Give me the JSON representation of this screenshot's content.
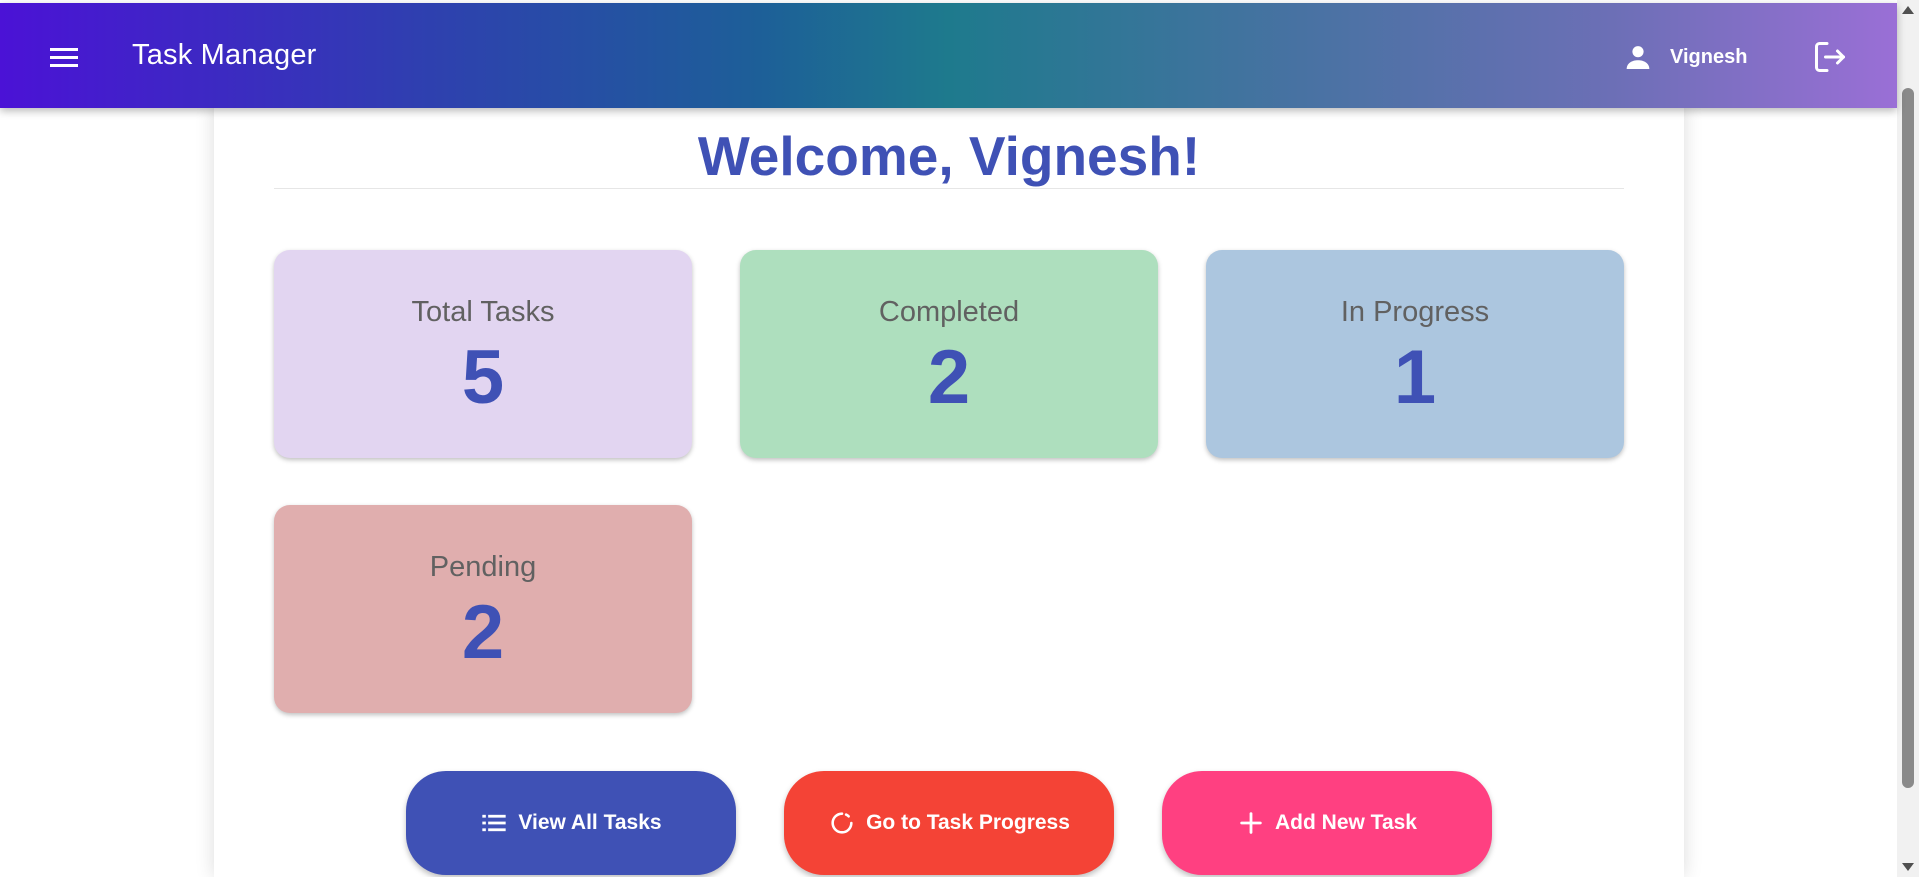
{
  "appbar": {
    "title": "Task Manager",
    "user_name": "Vignesh",
    "menu_icon": "menu-icon",
    "user_icon": "person-icon",
    "logout_icon": "logout-icon"
  },
  "main": {
    "welcome": "Welcome, Vignesh!"
  },
  "stats": [
    {
      "label": "Total Tasks",
      "value": "5",
      "color": "#e2d5f1"
    },
    {
      "label": "Completed",
      "value": "2",
      "color": "#aedfbe"
    },
    {
      "label": "In Progress",
      "value": "1",
      "color": "#acc6df"
    },
    {
      "label": "Pending",
      "value": "2",
      "color": "#e0aeae"
    }
  ],
  "actions": [
    {
      "label": "View All Tasks",
      "icon": "list-icon",
      "color": "#3f51b5"
    },
    {
      "label": "Go to Task Progress",
      "icon": "progress-icon",
      "color": "#f44336"
    },
    {
      "label": "Add New Task",
      "icon": "plus-icon",
      "color": "#ff4081"
    }
  ],
  "colors": {
    "accent": "#3f51b5"
  }
}
